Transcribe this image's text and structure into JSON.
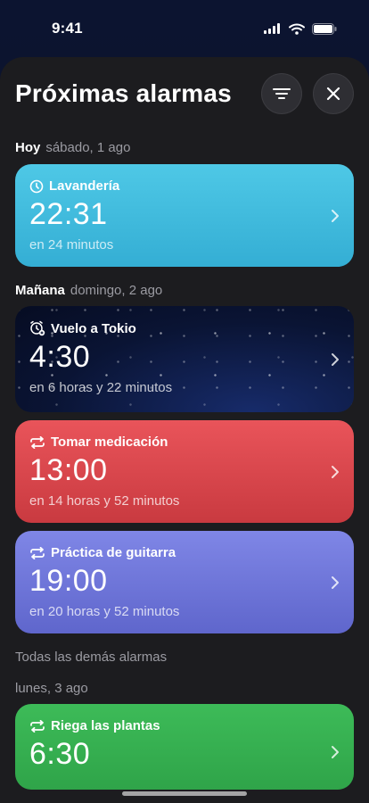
{
  "status": {
    "time": "9:41"
  },
  "header": {
    "title": "Próximas alarmas"
  },
  "sections": {
    "today": {
      "label": "Hoy",
      "date": "sábado, 1 ago"
    },
    "tomorrow": {
      "label": "Mañana",
      "date": "domingo, 2 ago"
    },
    "others": {
      "label": "Todas las demás alarmas"
    },
    "monday": {
      "label": "lunes, 3 ago"
    }
  },
  "alarms": [
    {
      "name": "Lavandería",
      "time": "22:31",
      "relative": "en 24 minutos",
      "icon": "clock-icon",
      "color": "#3fb8dd"
    },
    {
      "name": "Vuelo a Tokio",
      "time": "4:30",
      "relative": "en 6 horas y 22 minutos",
      "icon": "alarm-clock-icon",
      "color": "#0a1434"
    },
    {
      "name": "Tomar medicación",
      "time": "13:00",
      "relative": "en 14 horas y 52 minutos",
      "icon": "repeat-icon",
      "color": "#d9464c"
    },
    {
      "name": "Práctica de guitarra",
      "time": "19:00",
      "relative": "en 20 horas y 52 minutos",
      "icon": "repeat-icon",
      "color": "#6f76d9"
    },
    {
      "name": "Riega las plantas",
      "time": "6:30",
      "relative": "",
      "icon": "repeat-icon",
      "color": "#36b050"
    }
  ]
}
